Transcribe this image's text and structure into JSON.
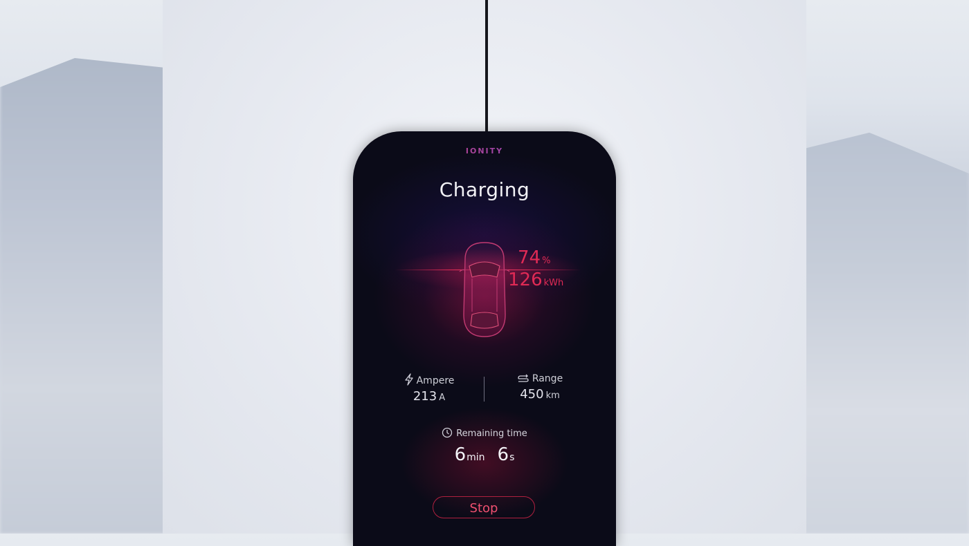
{
  "device": {
    "brand": "IONITY",
    "title": "Charging"
  },
  "battery": {
    "percent": "74",
    "percent_unit": "%",
    "energy": "126",
    "energy_unit": "kWh"
  },
  "stats": {
    "ampere": {
      "label": "Ampere",
      "value": "213",
      "unit": "A",
      "icon": "lightning-icon"
    },
    "range": {
      "label": "Range",
      "value": "450",
      "unit": "km",
      "icon": "range-icon"
    }
  },
  "remaining": {
    "label": "Remaining time",
    "icon": "clock-icon",
    "minutes": "6",
    "minutes_unit": "min",
    "seconds": "6",
    "seconds_unit": "s"
  },
  "actions": {
    "stop_label": "Stop"
  },
  "colors": {
    "accent": "#e02a55",
    "screen_bg": "#0b0b18"
  }
}
